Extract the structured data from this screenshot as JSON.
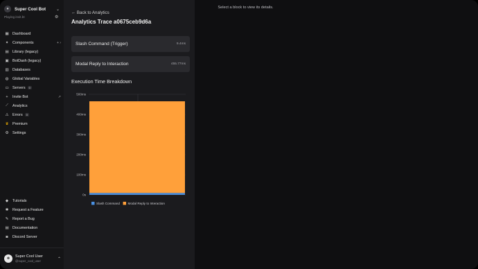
{
  "bot": {
    "name": "Super Cool Bot",
    "status": "Playing ",
    "status_link": "invit.bt",
    "avatar_icon": "bot-icon"
  },
  "nav": [
    {
      "label": "Dashboard",
      "icon": "grid-icon",
      "glyph": "▦"
    },
    {
      "label": "Components",
      "icon": "puzzle-icon",
      "glyph": "✦",
      "trail": "+  ›"
    },
    {
      "label": "Library (legacy)",
      "icon": "library-icon",
      "glyph": "▤"
    },
    {
      "label": "BotDash (legacy)",
      "icon": "dashboard-icon",
      "glyph": "▣"
    },
    {
      "label": "Databases",
      "icon": "database-icon",
      "glyph": "▥"
    },
    {
      "label": "Global Variables",
      "icon": "globe-icon",
      "glyph": "◍"
    },
    {
      "label": "Servers",
      "icon": "server-icon",
      "glyph": "▭",
      "badge": "0"
    },
    {
      "label": "Invite Bot",
      "icon": "plus-icon",
      "glyph": "+",
      "trail": "↗"
    },
    {
      "label": "Analytics",
      "icon": "analytics-icon",
      "glyph": "⟋"
    },
    {
      "label": "Errors",
      "icon": "error-icon",
      "glyph": "⚠",
      "badge": "0"
    },
    {
      "label": "Premium",
      "icon": "crown-icon",
      "glyph": "♛"
    },
    {
      "label": "Settings",
      "icon": "gear-icon",
      "glyph": "⚙"
    }
  ],
  "nav_bottom": [
    {
      "label": "Tutorials",
      "icon": "graduation-icon",
      "glyph": "◆"
    },
    {
      "label": "Request a Feature",
      "icon": "bulb-icon",
      "glyph": "✱"
    },
    {
      "label": "Report a Bug",
      "icon": "bug-icon",
      "glyph": "✎"
    },
    {
      "label": "Documentation",
      "icon": "book-icon",
      "glyph": "▤"
    },
    {
      "label": "Discord Server",
      "icon": "discord-icon",
      "glyph": "◙"
    }
  ],
  "user": {
    "name": "Super Cool User",
    "handle": "@super_cool_user"
  },
  "main": {
    "back_label": "Back to Analytics",
    "trace_title": "Analytics Trace a0675ceb9d6a",
    "blocks": [
      {
        "name": "Slash Command (Trigger)",
        "duration": "9.4ms"
      },
      {
        "name": "Modal Reply to Interaction",
        "duration": "455.77ms"
      }
    ],
    "section_title": "Execution Time Breakdown"
  },
  "chart_data": {
    "type": "bar",
    "stacked": true,
    "categories": [
      ""
    ],
    "series": [
      {
        "name": "Slash Command",
        "color": "#4a90e2",
        "values": [
          9.4
        ]
      },
      {
        "name": "Modal Reply to Interaction",
        "color": "#ffa03a",
        "values": [
          455.77
        ]
      }
    ],
    "ylim": [
      0,
      500
    ],
    "yticks": [
      "0s",
      "100ms",
      "200ms",
      "300ms",
      "400ms",
      "500ms"
    ],
    "grid": true,
    "legend": "bottom"
  },
  "detail": {
    "hint": "Select a block to view its details."
  },
  "colors": {
    "accent_blue": "#4a90e2",
    "accent_orange": "#ffa03a",
    "premium": "#f5b400"
  }
}
